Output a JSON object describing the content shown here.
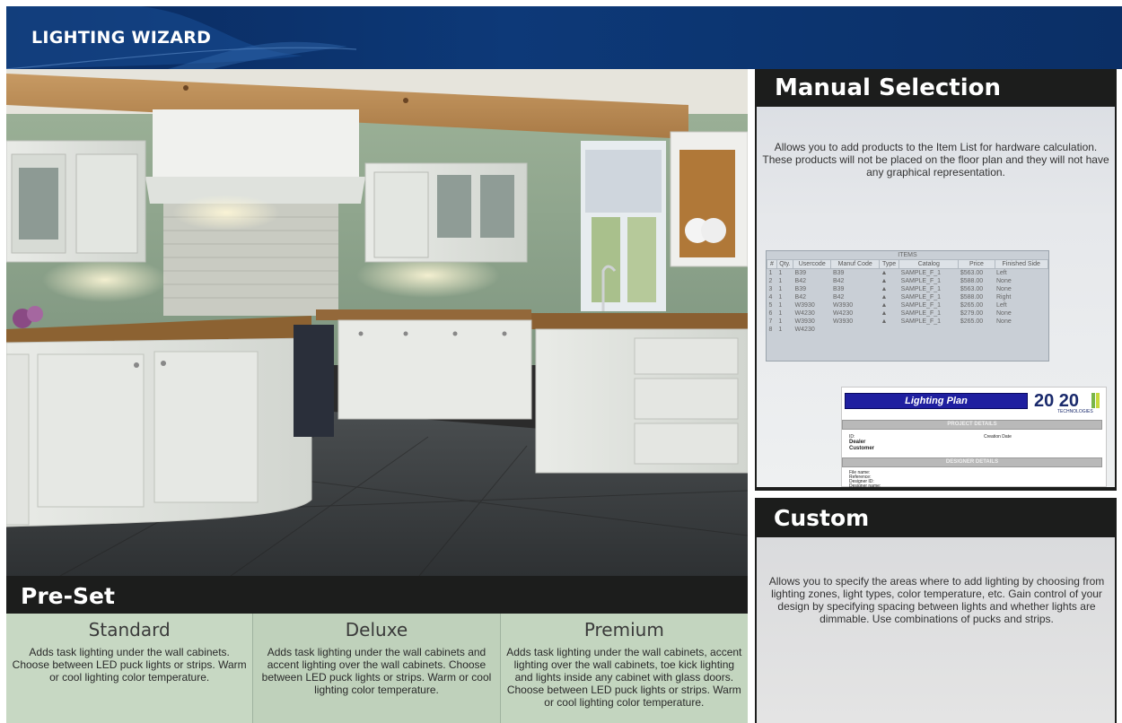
{
  "app": {
    "title": "LIGHTING WIZARD"
  },
  "preset": {
    "heading": "Pre-Set",
    "options": [
      {
        "name": "Standard",
        "description": "Adds task lighting under the wall cabinets. Choose between LED puck lights or strips. Warm or cool lighting color temperature."
      },
      {
        "name": "Deluxe",
        "description": "Adds task lighting under the wall cabinets and accent lighting over the wall cabinets. Choose between LED puck lights or strips. Warm or cool lighting color temperature."
      },
      {
        "name": "Premium",
        "description": "Adds task lighting under the wall cabinets, accent lighting over the wall cabinets, toe kick lighting and lights inside any cabinet with glass doors. Choose between LED puck lights or strips. Warm or cool lighting color temperature."
      }
    ]
  },
  "manual": {
    "heading": "Manual Selection",
    "description": "Allows you to add products to the Item List for hardware calculation. These products will not be placed on the floor plan and they will not have any graphical representation.",
    "items": {
      "caption": "ITEMS",
      "columns": [
        "#",
        "Qty.",
        "Usercode",
        "Manuf Code",
        "Type",
        "Catalog",
        "Price",
        "Finished Side"
      ],
      "rows": [
        [
          "1",
          "1",
          "B39",
          "B39",
          "▲",
          "SAMPLE_F_1",
          "$563.00",
          "Left"
        ],
        [
          "2",
          "1",
          "B42",
          "B42",
          "▲",
          "SAMPLE_F_1",
          "$588.00",
          "None"
        ],
        [
          "3",
          "1",
          "B39",
          "B39",
          "▲",
          "SAMPLE_F_1",
          "$563.00",
          "None"
        ],
        [
          "4",
          "1",
          "B42",
          "B42",
          "▲",
          "SAMPLE_F_1",
          "$588.00",
          "Right"
        ],
        [
          "5",
          "1",
          "W3930",
          "W3930",
          "▲",
          "SAMPLE_F_1",
          "$265.00",
          "Left"
        ],
        [
          "6",
          "1",
          "W4230",
          "W4230",
          "▲",
          "SAMPLE_F_1",
          "$279.00",
          "None"
        ],
        [
          "7",
          "1",
          "W3930",
          "W3930",
          "▲",
          "SAMPLE_F_1",
          "$265.00",
          "None"
        ],
        [
          "8",
          "1",
          "W4230",
          "",
          "",
          "",
          "",
          ""
        ]
      ]
    },
    "plan": {
      "title": "Lighting Plan",
      "logo": "20 20",
      "logo_sub": "TECHNOLOGIES",
      "project_bar": "PROJECT DETAILS",
      "designer_bar": "DESIGNER DETAILS",
      "id_label": "ID:",
      "creation_label": "Creation Date",
      "dealer_label": "Dealer",
      "customer_label": "Customer",
      "file_label": "File name:",
      "reference_label": "Reference:",
      "designer_id_label": "Designer ID:",
      "designer_name_label": "Designer name:"
    }
  },
  "custom": {
    "heading": "Custom",
    "description": "Allows you to specify the areas where to add lighting by choosing from lighting zones, light types, color temperature, etc.  Gain control of your design by specifying spacing between lights and whether lights are dimmable.  Use combinations of pucks and strips."
  },
  "colors": {
    "header_bg": "#0d3978",
    "panel_head_bg": "#1c1d1c",
    "preset_bg": "#c7d8c3"
  }
}
